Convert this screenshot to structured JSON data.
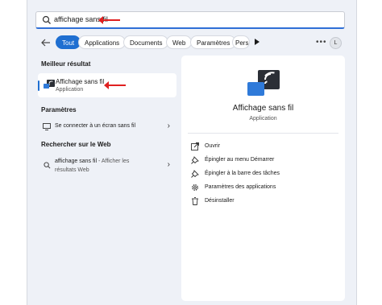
{
  "search": {
    "query": "affichage sans fil"
  },
  "filters": {
    "tabs": [
      "Tout",
      "Applications",
      "Documents",
      "Web",
      "Paramètres",
      "Pers"
    ],
    "active": "Tout",
    "avatar_initial": "L"
  },
  "best_match": {
    "heading": "Meilleur résultat",
    "name": "Affichage sans fil",
    "type": "Application"
  },
  "settings": {
    "heading": "Paramètres",
    "item": "Se connecter à un écran sans fil"
  },
  "web": {
    "heading": "Rechercher sur le Web",
    "item_strong": "affichage sans fil",
    "item_rest": " - Afficher les",
    "item_line2": "résultats Web"
  },
  "detail": {
    "title": "Affichage sans fil",
    "subtitle": "Application",
    "actions": [
      {
        "label": "Ouvrir",
        "icon": "open-icon"
      },
      {
        "label": "Épingler au menu Démarrer",
        "icon": "pin-icon"
      },
      {
        "label": "Épingler à la barre des tâches",
        "icon": "pin-icon"
      },
      {
        "label": "Paramètres des applications",
        "icon": "gear-icon"
      },
      {
        "label": "Désinstaller",
        "icon": "trash-icon"
      }
    ]
  },
  "colors": {
    "accent": "#1f6fd1",
    "annotation_arrow": "#e02020",
    "panel_bg": "#eef1f7"
  }
}
